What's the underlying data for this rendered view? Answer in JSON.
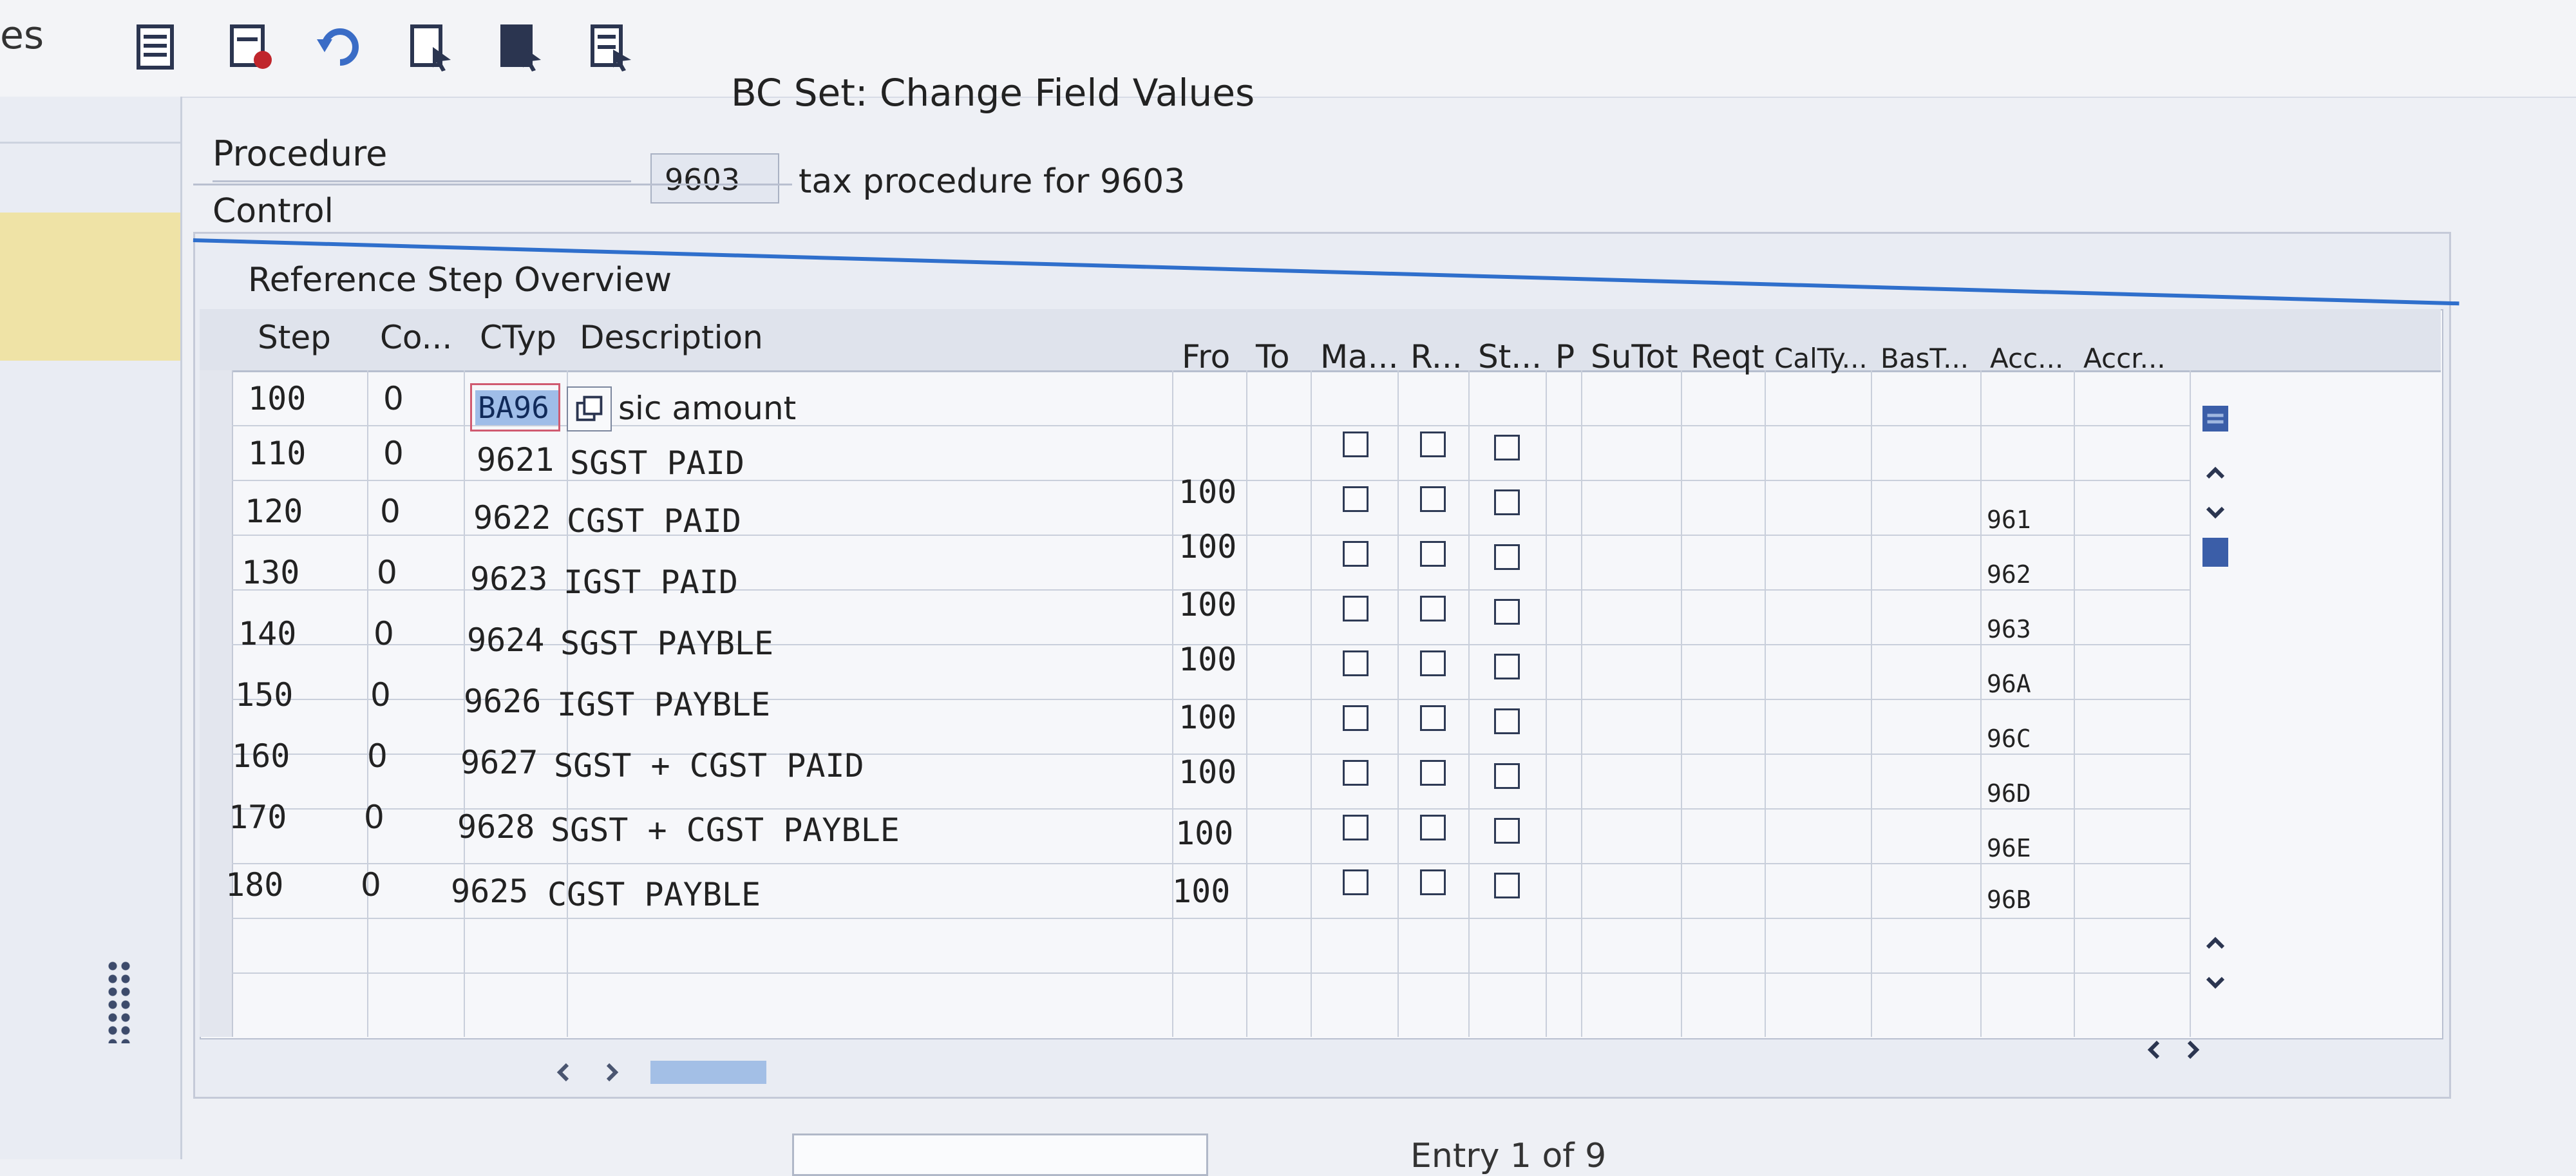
{
  "nav": {
    "partial_text": "es"
  },
  "toolbar": {
    "items": [
      "table-view-icon",
      "delete-row-icon",
      "undo-icon",
      "select-all-icon",
      "select-block-icon",
      "deselect-all-icon"
    ]
  },
  "title": "BC Set: Change Field Values",
  "procedure": {
    "label": "Procedure",
    "value": "9603",
    "description": "tax procedure for 9603"
  },
  "tab": {
    "label": "Control"
  },
  "group": {
    "title": "Reference Step Overview"
  },
  "table": {
    "headers": [
      "Step",
      "Co...",
      "CTyp",
      "Description",
      "Fro",
      "To",
      "Ma...",
      "R...",
      "St...",
      "P",
      "SuTot",
      "Reqt",
      "CalTy...",
      "BasT...",
      "Acc...",
      "Accr..."
    ],
    "rows": [
      {
        "step": "100",
        "co": "0",
        "ctyp": "BA96",
        "desc": "sic amount",
        "fro": "",
        "to": "",
        "acc": ""
      },
      {
        "step": "110",
        "co": "0",
        "ctyp": "9621",
        "desc": "SGST PAID",
        "fro": "100",
        "to": "",
        "acc": ""
      },
      {
        "step": "120",
        "co": "0",
        "ctyp": "9622",
        "desc": "CGST PAID",
        "fro": "100",
        "to": "",
        "acc": "961"
      },
      {
        "step": "130",
        "co": "0",
        "ctyp": "9623",
        "desc": "IGST PAID",
        "fro": "100",
        "to": "",
        "acc": "962"
      },
      {
        "step": "140",
        "co": "0",
        "ctyp": "9624",
        "desc": "SGST PAYBLE",
        "fro": "100",
        "to": "",
        "acc": "963"
      },
      {
        "step": "150",
        "co": "0",
        "ctyp": "9626",
        "desc": "IGST PAYBLE",
        "fro": "100",
        "to": "",
        "acc": "96A"
      },
      {
        "step": "160",
        "co": "0",
        "ctyp": "9627",
        "desc": "SGST + CGST PAID",
        "fro": "100",
        "to": "",
        "acc": "96C"
      },
      {
        "step": "170",
        "co": "0",
        "ctyp": "9628",
        "desc": "SGST + CGST PAYBLE",
        "fro": "100",
        "to": "",
        "acc": "96D"
      },
      {
        "step": "180",
        "co": "0",
        "ctyp": "9625",
        "desc": "CGST PAYBLE",
        "fro": "100",
        "to": "",
        "acc": "96E"
      }
    ],
    "extra_acc": "96B"
  },
  "footer": {
    "entry_text": "Entry 1 of 9"
  },
  "colors": {
    "focus_bg": "#9fbde8",
    "accent": "#2f6fcc",
    "selection": "#efe3a6"
  }
}
